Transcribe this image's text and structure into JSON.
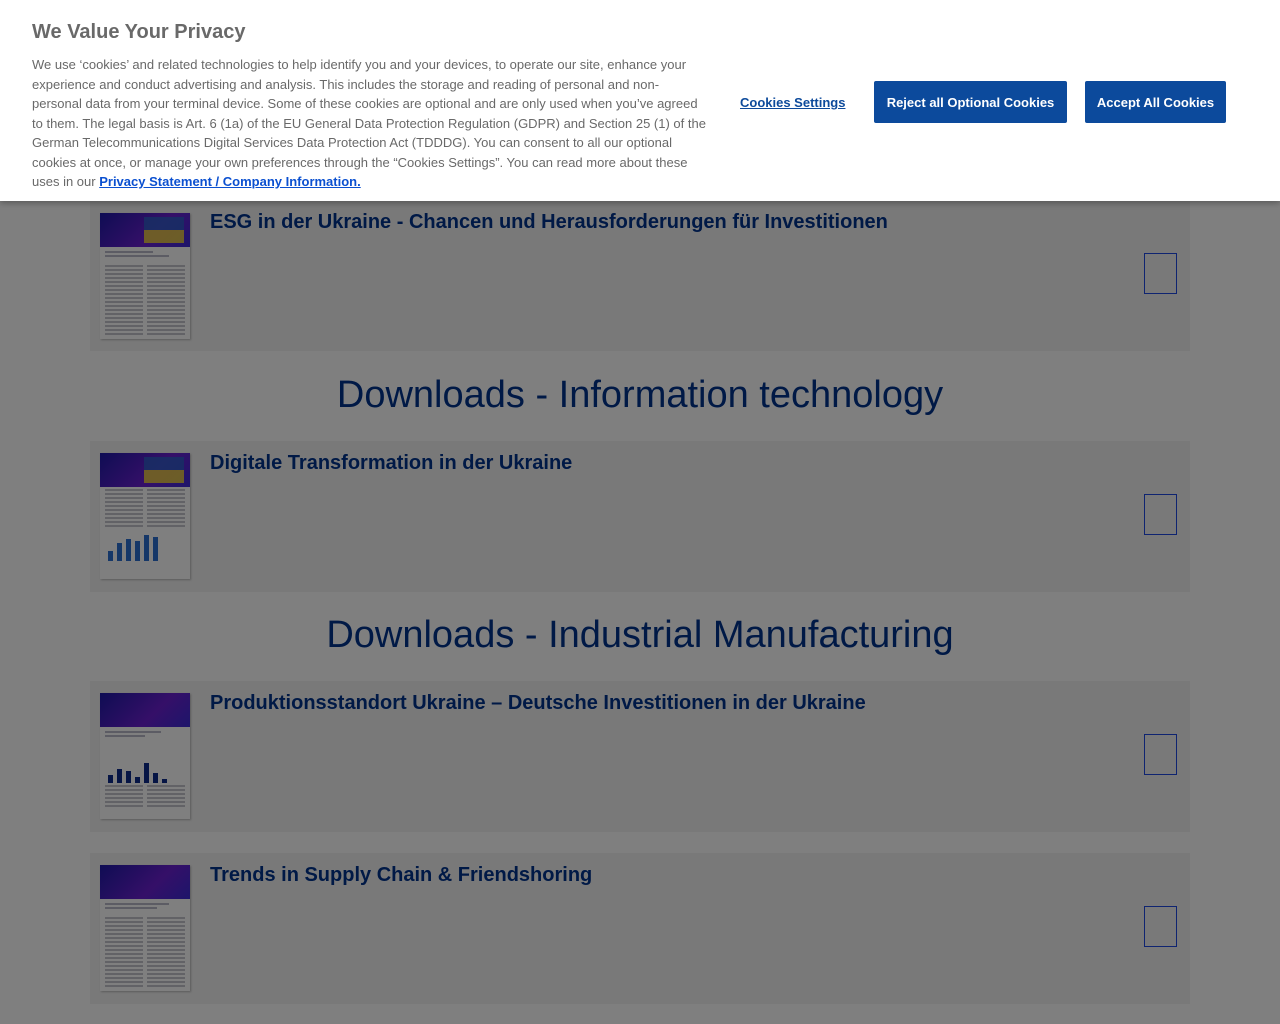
{
  "sections": {
    "it_heading": "Downloads - Information technology",
    "manufacturing_heading": "Downloads - Industrial Manufacturing"
  },
  "cards": {
    "esg": {
      "title": "ESG in der Ukraine - Chancen und Herausforderungen für Investitionen"
    },
    "digital": {
      "title": "Digitale Transformation in der Ukraine"
    },
    "production": {
      "title": "Produktionsstandort Ukraine – Deutsche Investitionen in der Ukraine"
    },
    "supply": {
      "title": "Trends in Supply Chain & Friendshoring"
    }
  },
  "cookie_banner": {
    "title": "We Value Your Privacy",
    "body": "We use ‘cookies’ and related technologies to help identify you and your devices, to operate our site, enhance your experience and conduct advertising and analysis. This includes the storage and reading of personal and non-personal data from your terminal device. Some of these cookies are optional and are only used when you’ve agreed to them. The legal basis is Art. 6 (1a) of the EU General Data Protection Regulation (GDPR) and Section 25 (1) of the German Telecommunications Digital Services Data Protection Act (TDDDG). You can consent to all our optional cookies at once, or manage your own preferences through the “Cookies Settings”. You can read more about these uses in our",
    "link_label": "Privacy Statement / Company Information.",
    "settings_label": "Cookies Settings",
    "reject_label": "Reject all Optional Cookies",
    "accept_label": "Accept All Cookies"
  },
  "colors": {
    "brand_blue": "#00338d",
    "button_blue": "#0c4a9c",
    "outline_blue": "#1e49e2"
  }
}
